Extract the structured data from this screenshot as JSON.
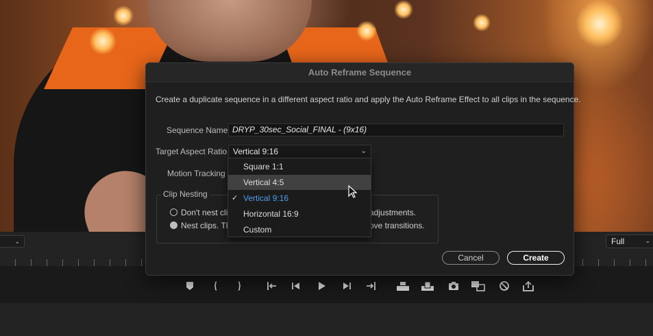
{
  "dialog": {
    "title": "Auto Reframe Sequence",
    "description": "Create a duplicate sequence in a different aspect ratio and apply the Auto Reframe Effect to all clips in the sequence.",
    "sequence_name_label": "Sequence Name",
    "sequence_name_value": "DRYP_30sec_Social_FINAL - (9x16)",
    "target_aspect_label": "Target Aspect Ratio",
    "target_aspect_value": "Vertical 9:16",
    "motion_tracking_label": "Motion Tracking",
    "clip_nesting": {
      "legend": "Clip Nesting",
      "options": [
        {
          "visible_start": "Don't nest cli",
          "visible_end": "adjustments.",
          "selected": false
        },
        {
          "visible_start": "Nest clips. Th",
          "visible_end": "ove transitions.",
          "selected": true
        }
      ]
    },
    "cancel_label": "Cancel",
    "create_label": "Create"
  },
  "aspect_menu": {
    "items": [
      {
        "label": "Square 1:1",
        "state": "normal"
      },
      {
        "label": "Vertical 4:5",
        "state": "hover"
      },
      {
        "label": "Vertical 9:16",
        "state": "selected"
      },
      {
        "label": "Horizontal 16:9",
        "state": "normal"
      },
      {
        "label": "Custom",
        "state": "normal"
      }
    ],
    "check_glyph": "✓"
  },
  "monitor": {
    "resolution_value": "Full"
  },
  "transport_icons": [
    "add-marker-icon",
    "mark-in-icon",
    "mark-out-icon",
    "go-to-in-icon",
    "step-back-icon",
    "play-icon",
    "step-forward-icon",
    "go-to-out-icon",
    "insert-icon",
    "overwrite-icon",
    "export-frame-icon",
    "comparison-view-icon",
    "vr-video-icon",
    "share-icon"
  ],
  "colors": {
    "accent_selected": "#4f9cf0",
    "dialog_bg": "#1f1f1f",
    "menu_hover": "#414141"
  }
}
